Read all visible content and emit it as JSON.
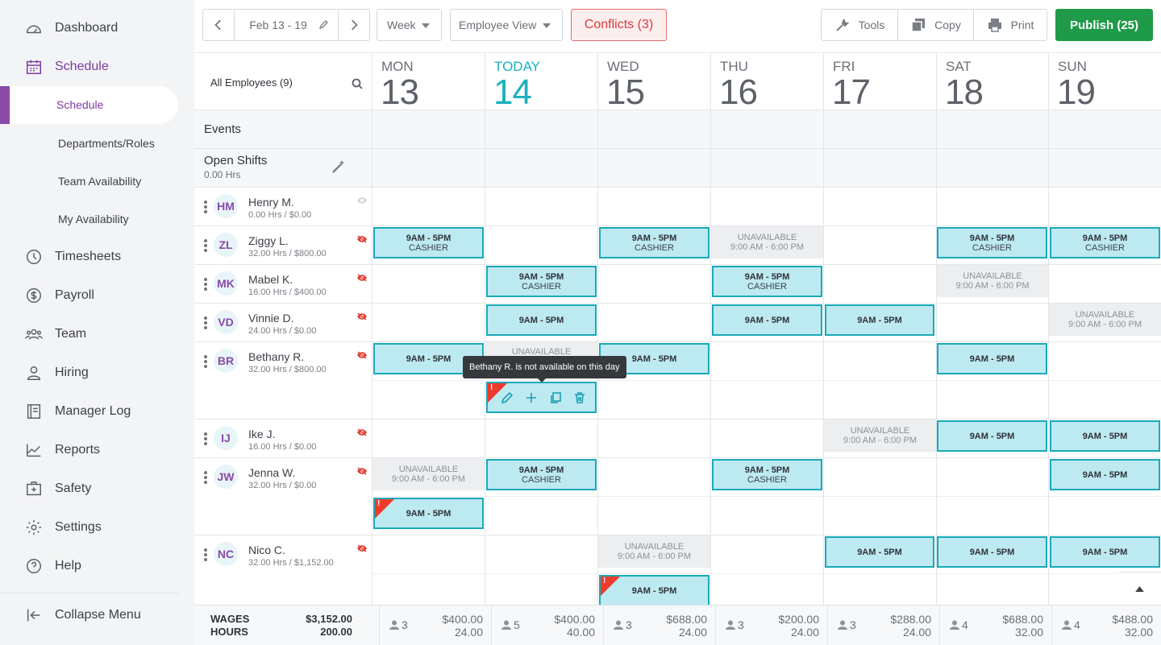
{
  "sidebar": {
    "items": [
      {
        "label": "Dashboard",
        "icon": "dashboard-icon"
      },
      {
        "label": "Schedule",
        "icon": "calendar-icon"
      },
      {
        "label": "Timesheets",
        "icon": "clock-icon"
      },
      {
        "label": "Payroll",
        "icon": "dollar-icon"
      },
      {
        "label": "Team",
        "icon": "team-icon"
      },
      {
        "label": "Hiring",
        "icon": "person-icon"
      },
      {
        "label": "Manager Log",
        "icon": "logbook-icon"
      },
      {
        "label": "Reports",
        "icon": "chart-icon"
      },
      {
        "label": "Safety",
        "icon": "first-aid-icon"
      },
      {
        "label": "Settings",
        "icon": "gear-icon"
      },
      {
        "label": "Help",
        "icon": "help-icon"
      }
    ],
    "sub_items": [
      "Schedule",
      "Departments/Roles",
      "Team Availability",
      "My Availability"
    ],
    "collapse": "Collapse Menu"
  },
  "toolbar": {
    "date_range": "Feb 13 - 19",
    "period": "Week",
    "view": "Employee View",
    "conflicts": "Conflicts  (3)",
    "tools": "Tools",
    "copy": "Copy",
    "print": "Print",
    "publish": "Publish (25)"
  },
  "grid": {
    "employees_filter": "All Employees (9)",
    "events_label": "Events",
    "open_shifts_label": "Open Shifts",
    "open_shifts_hours": "0.00 Hrs",
    "days": [
      {
        "name": "MON",
        "num": "13"
      },
      {
        "name": "TODAY",
        "num": "14"
      },
      {
        "name": "WED",
        "num": "15"
      },
      {
        "name": "THU",
        "num": "16"
      },
      {
        "name": "FRI",
        "num": "17"
      },
      {
        "name": "SAT",
        "num": "18"
      },
      {
        "name": "SUN",
        "num": "19"
      }
    ],
    "employees": [
      {
        "initials": "HM",
        "name": "Henry M.",
        "hours": "0.00 Hrs / $0.00"
      },
      {
        "initials": "ZL",
        "name": "Ziggy L.",
        "hours": "32.00 Hrs / $800.00"
      },
      {
        "initials": "MK",
        "name": "Mabel K.",
        "hours": "16.00 Hrs / $400.00"
      },
      {
        "initials": "VD",
        "name": "Vinnie D.",
        "hours": "24.00 Hrs / $0.00"
      },
      {
        "initials": "BR",
        "name": "Bethany R.",
        "hours": "32.00 Hrs / $800.00"
      },
      {
        "initials": "IJ",
        "name": "Ike J.",
        "hours": "16.00 Hrs / $0.00"
      },
      {
        "initials": "JW",
        "name": "Jenna W.",
        "hours": "32.00 Hrs / $0.00"
      },
      {
        "initials": "NC",
        "name": "Nico C.",
        "hours": "32.00 Hrs / $1,152.00"
      }
    ],
    "shift_time": "9AM - 5PM",
    "role_cashier": "CASHIER",
    "unavailable": "UNAVAILABLE",
    "unavailable_time": "9:00 AM - 6:00 PM",
    "tooltip": "Bethany R. is not available on this day",
    "tooltip_underlay": "UNAVAILABLE",
    "flag_mark": "!"
  },
  "footer": {
    "wages_label": "WAGES",
    "hours_label": "HOURS",
    "total_wages": "$3,152.00",
    "total_hours": "200.00",
    "days": [
      {
        "count": "3",
        "wages": "$400.00",
        "hours": "24.00"
      },
      {
        "count": "5",
        "wages": "$400.00",
        "hours": "40.00"
      },
      {
        "count": "3",
        "wages": "$688.00",
        "hours": "24.00"
      },
      {
        "count": "3",
        "wages": "$200.00",
        "hours": "24.00"
      },
      {
        "count": "3",
        "wages": "$288.00",
        "hours": "24.00"
      },
      {
        "count": "4",
        "wages": "$688.00",
        "hours": "32.00"
      },
      {
        "count": "4",
        "wages": "$488.00",
        "hours": "32.00"
      }
    ]
  },
  "colors": {
    "brand": "#7b3aa0",
    "today": "#1ab0bf",
    "shift_fill": "#bde9f1",
    "shift_border": "#1aa9b8",
    "publish": "#1f9a48",
    "conflict": "#d93a3a"
  }
}
